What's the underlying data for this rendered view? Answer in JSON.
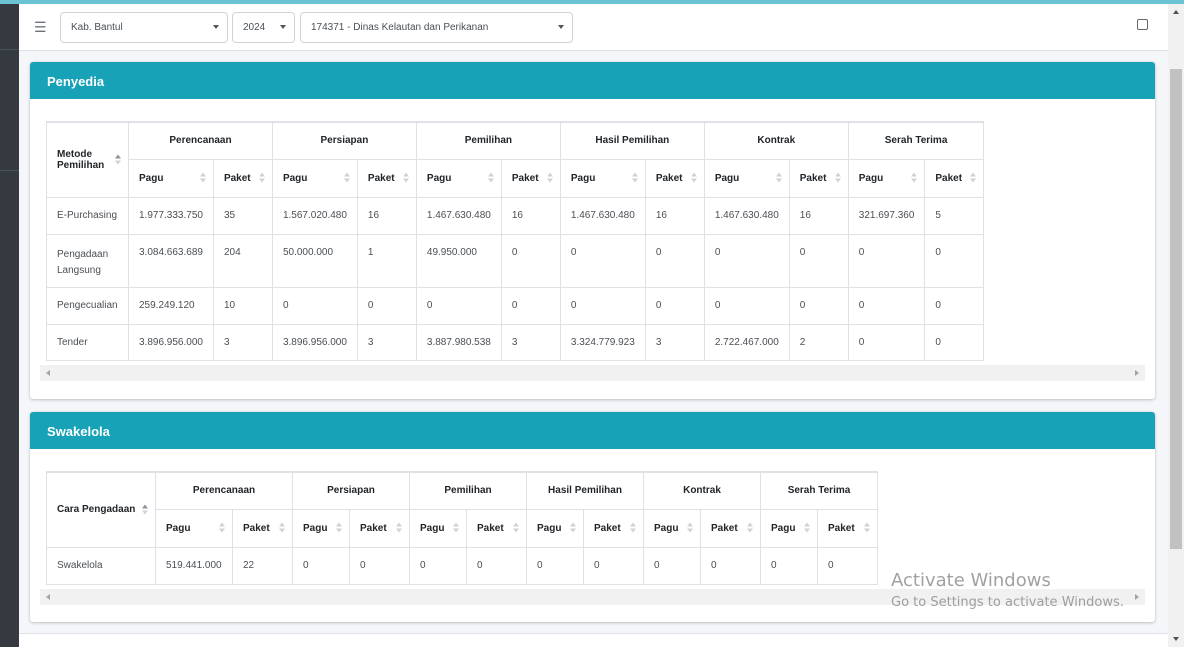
{
  "filters": {
    "region": "Kab. Bantul",
    "year": "2024",
    "unit": "174371 - Dinas Kelautan dan Perikanan"
  },
  "penyedia": {
    "title": "Penyedia",
    "first_col": [
      "Metode",
      "Pemilihan"
    ],
    "groups": [
      "Perencanaan",
      "Persiapan",
      "Pemilihan",
      "Hasil Pemilihan",
      "Kontrak",
      "Serah Terima"
    ],
    "sub": {
      "pagu": "Pagu",
      "paket": "Paket"
    },
    "rows": [
      {
        "name": [
          "E-Purchasing"
        ],
        "values": [
          "1.977.333.750",
          "35",
          "1.567.020.480",
          "16",
          "1.467.630.480",
          "16",
          "1.467.630.480",
          "16",
          "1.467.630.480",
          "16",
          "321.697.360",
          "5"
        ]
      },
      {
        "name": [
          "Pengadaan",
          "Langsung"
        ],
        "values": [
          "3.084.663.689",
          "204",
          "50.000.000",
          "1",
          "49.950.000",
          "0",
          "0",
          "0",
          "0",
          "0",
          "0",
          "0"
        ]
      },
      {
        "name": [
          "Pengecualian"
        ],
        "values": [
          "259.249.120",
          "10",
          "0",
          "0",
          "0",
          "0",
          "0",
          "0",
          "0",
          "0",
          "0",
          "0"
        ]
      },
      {
        "name": [
          "Tender"
        ],
        "values": [
          "3.896.956.000",
          "3",
          "3.896.956.000",
          "3",
          "3.887.980.538",
          "3",
          "3.324.779.923",
          "3",
          "2.722.467.000",
          "2",
          "0",
          "0"
        ]
      }
    ]
  },
  "swakelola": {
    "title": "Swakelola",
    "first_col": "Cara Pengadaan",
    "groups": [
      "Perencanaan",
      "Persiapan",
      "Pemilihan",
      "Hasil Pemilihan",
      "Kontrak",
      "Serah Terima"
    ],
    "sub": {
      "pagu": "Pagu",
      "paket": "Paket"
    },
    "rows": [
      {
        "name": "Swakelola",
        "values": [
          "519.441.000",
          "22",
          "0",
          "0",
          "0",
          "0",
          "0",
          "0",
          "0",
          "0",
          "0",
          "0"
        ]
      }
    ]
  },
  "watermark": {
    "line1": "Activate Windows",
    "line2": "Go to Settings to activate Windows."
  }
}
